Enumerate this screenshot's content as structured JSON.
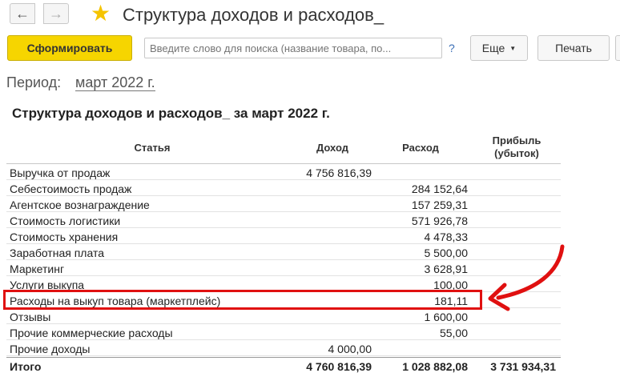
{
  "window": {
    "title": "Структура доходов и расходов_"
  },
  "toolbar": {
    "form_label": "Сформировать",
    "search_placeholder": "Введите слово для поиска (название товара, по...",
    "help_label": "?",
    "more_label": "Еще",
    "print_label": "Печать"
  },
  "period": {
    "label": "Период:",
    "value": "март 2022 г."
  },
  "report": {
    "title": "Структура доходов и расходов_ за март 2022 г.",
    "columns": {
      "item": "Статья",
      "income": "Доход",
      "expense": "Расход",
      "profit_line1": "Прибыль",
      "profit_line2": "(убыток)"
    },
    "rows": [
      {
        "name": "Выручка от продаж",
        "income": "4 756 816,39",
        "expense": "",
        "profit": ""
      },
      {
        "name": "Себестоимость продаж",
        "income": "",
        "expense": "284 152,64",
        "profit": ""
      },
      {
        "name": "Агентское вознаграждение",
        "income": "",
        "expense": "157 259,31",
        "profit": ""
      },
      {
        "name": "Стоимость логистики",
        "income": "",
        "expense": "571 926,78",
        "profit": ""
      },
      {
        "name": "Стоимость хранения",
        "income": "",
        "expense": "4 478,33",
        "profit": ""
      },
      {
        "name": "Заработная плата",
        "income": "",
        "expense": "5 500,00",
        "profit": ""
      },
      {
        "name": "Маркетинг",
        "income": "",
        "expense": "3 628,91",
        "profit": ""
      },
      {
        "name": "Услуги выкупа",
        "income": "",
        "expense": "100,00",
        "profit": ""
      },
      {
        "name": "Расходы на выкуп товара (маркетплейс)",
        "income": "",
        "expense": "181,11",
        "profit": ""
      },
      {
        "name": "Отзывы",
        "income": "",
        "expense": "1 600,00",
        "profit": ""
      },
      {
        "name": "Прочие коммерческие расходы",
        "income": "",
        "expense": "55,00",
        "profit": ""
      },
      {
        "name": "Прочие доходы",
        "income": "4 000,00",
        "expense": "",
        "profit": ""
      }
    ],
    "total": {
      "name": "Итого",
      "income": "4 760 816,39",
      "expense": "1 028 882,08",
      "profit": "3 731 934,31"
    }
  },
  "annotation": {
    "highlight_color": "#e01010"
  }
}
